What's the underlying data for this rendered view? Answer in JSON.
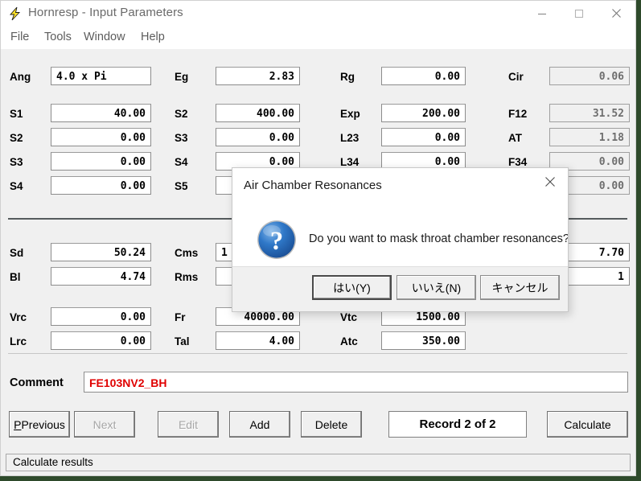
{
  "window": {
    "title": "Hornresp - Input Parameters",
    "icon": "lightning-bolt-icon",
    "controls": {
      "minimize": "minimize-icon",
      "maximize": "maximize-icon",
      "close": "close-icon"
    }
  },
  "menu": {
    "items": [
      "File",
      "Tools",
      "Window",
      "Help"
    ]
  },
  "fields": {
    "col1": [
      {
        "label": "Ang",
        "value": "4.0 x Pi",
        "readonly": false,
        "align": "left"
      },
      {
        "label": "S1",
        "value": "40.00",
        "readonly": false,
        "align": "right"
      },
      {
        "label": "S2",
        "value": "0.00",
        "readonly": false,
        "align": "right"
      },
      {
        "label": "S3",
        "value": "0.00",
        "readonly": false,
        "align": "right"
      },
      {
        "label": "S4",
        "value": "0.00",
        "readonly": false,
        "align": "right"
      },
      {
        "label": "Sd",
        "value": "50.24",
        "readonly": false,
        "align": "right"
      },
      {
        "label": "Bl",
        "value": "4.74",
        "readonly": false,
        "align": "right"
      },
      {
        "label": "Vrc",
        "value": "0.00",
        "readonly": false,
        "align": "right"
      },
      {
        "label": "Lrc",
        "value": "0.00",
        "readonly": false,
        "align": "right"
      }
    ],
    "col2": [
      {
        "label": "Eg",
        "value": "2.83",
        "readonly": false,
        "align": "right"
      },
      {
        "label": "S2",
        "value": "400.00",
        "readonly": false,
        "align": "right"
      },
      {
        "label": "S3",
        "value": "0.00",
        "readonly": false,
        "align": "right"
      },
      {
        "label": "S4",
        "value": "0.00",
        "readonly": false,
        "align": "right"
      },
      {
        "label": "S5",
        "value": "",
        "readonly": false,
        "align": "right"
      },
      {
        "label": "Cms",
        "value": "1",
        "readonly": false,
        "align": "left"
      },
      {
        "label": "Rms",
        "value": "",
        "readonly": false,
        "align": "right"
      },
      {
        "label": "Fr",
        "value": "40000.00",
        "readonly": false,
        "align": "right"
      },
      {
        "label": "Tal",
        "value": "4.00",
        "readonly": false,
        "align": "right"
      }
    ],
    "col3": [
      {
        "label": "Rg",
        "value": "0.00",
        "readonly": false,
        "align": "right"
      },
      {
        "label": "Exp",
        "value": "200.00",
        "readonly": false,
        "align": "right"
      },
      {
        "label": "L23",
        "value": "0.00",
        "readonly": false,
        "align": "right"
      },
      {
        "label": "L34",
        "value": "0.00",
        "readonly": false,
        "align": "right"
      },
      {
        "label": "",
        "value": "",
        "readonly": false,
        "align": "right"
      },
      {
        "label": "",
        "value": "7.70",
        "readonly": false,
        "align": "right"
      },
      {
        "label": "",
        "value": "1",
        "readonly": false,
        "align": "right"
      },
      {
        "label": "Vtc",
        "value": "1500.00",
        "readonly": false,
        "align": "right"
      },
      {
        "label": "Atc",
        "value": "350.00",
        "readonly": false,
        "align": "right"
      }
    ],
    "col4": [
      {
        "label": "Cir",
        "value": "0.06",
        "readonly": true,
        "align": "right"
      },
      {
        "label": "F12",
        "value": "31.52",
        "readonly": true,
        "align": "right"
      },
      {
        "label": "AT",
        "value": "1.18",
        "readonly": true,
        "align": "right"
      },
      {
        "label": "F34",
        "value": "0.00",
        "readonly": true,
        "align": "right"
      },
      {
        "label": "",
        "value": "0.00",
        "readonly": true,
        "align": "right"
      }
    ]
  },
  "comment": {
    "label": "Comment",
    "value": "FE103NV2_BH",
    "color": "#e00000"
  },
  "buttons": {
    "previous": {
      "label": "Previous",
      "accel": "P",
      "disabled": false
    },
    "next": {
      "label": "Next",
      "accel": "N",
      "disabled": true
    },
    "edit": {
      "label": "Edit",
      "accel": "E",
      "disabled": true
    },
    "add": {
      "label": "Add",
      "accel": "A",
      "disabled": false
    },
    "delete": {
      "label": "Delete",
      "accel": "D",
      "disabled": false
    },
    "record": {
      "label": "Record 2 of 2"
    },
    "calculate": {
      "label": "Calculate",
      "accel": "C",
      "disabled": false
    }
  },
  "statusbar": {
    "text": "Calculate results"
  },
  "dialog": {
    "title": "Air Chamber Resonances",
    "message": "Do you want to mask throat chamber resonances?",
    "icon": "question-icon",
    "close": "close-icon",
    "buttons": [
      {
        "label": "はい(Y)",
        "default": true
      },
      {
        "label": "いいえ(N)",
        "default": false
      },
      {
        "label": "キャンセル",
        "default": false
      }
    ]
  }
}
